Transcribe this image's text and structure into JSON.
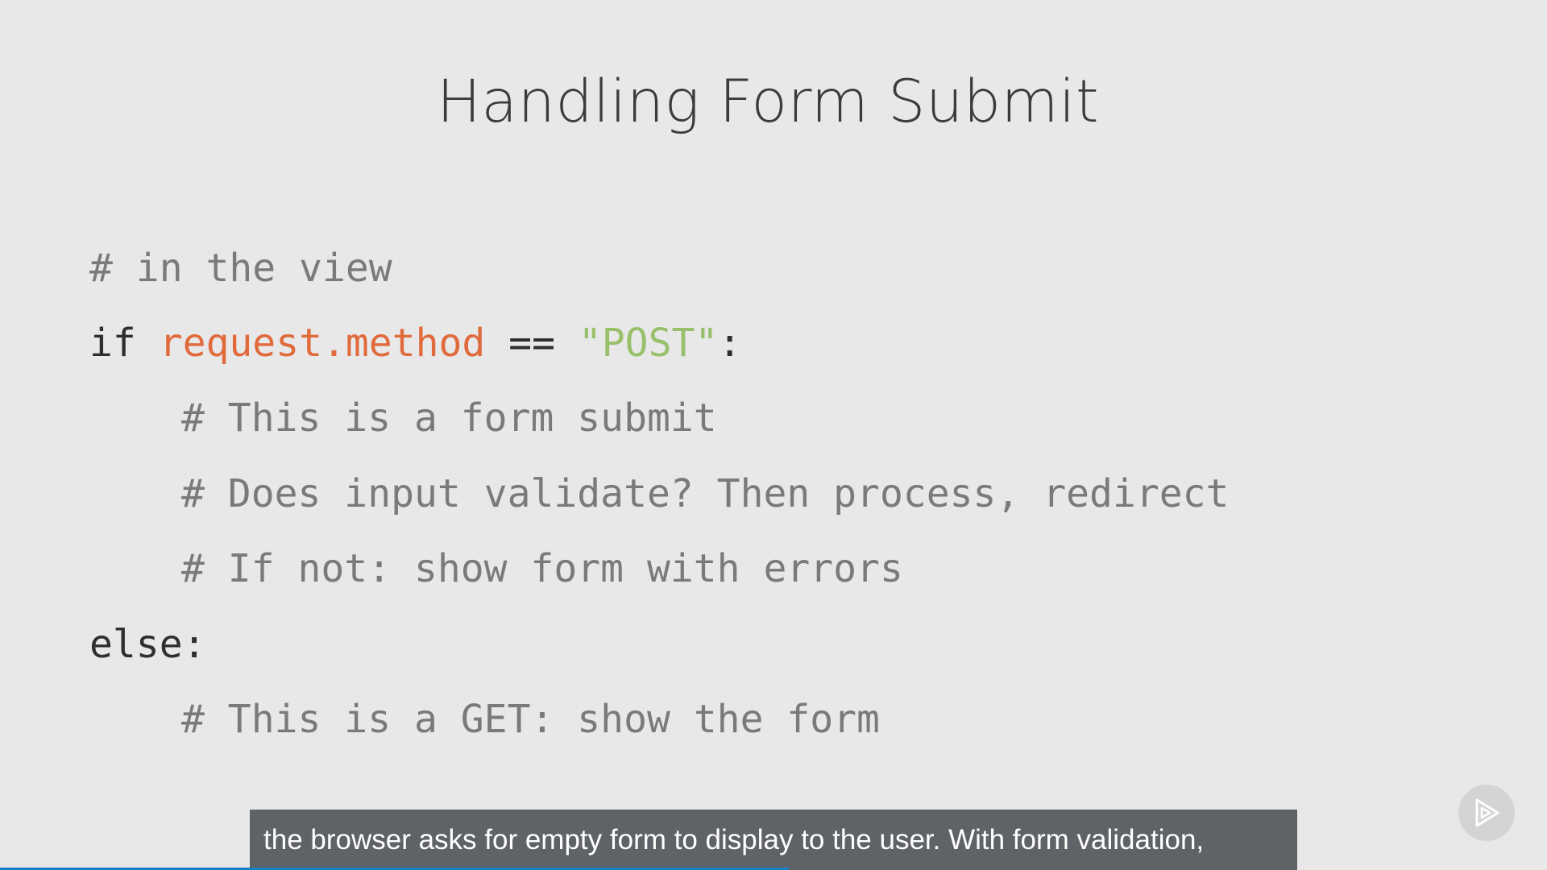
{
  "slide": {
    "title": "Handling Form Submit",
    "code": {
      "line1": "# in the view",
      "line2_kw": "if ",
      "line2_attr": "request.method",
      "line2_op": " == ",
      "line2_str": "\"POST\"",
      "line2_colon": ":",
      "line3": "# This is a form submit",
      "line4": "# Does input validate? Then process, redirect",
      "line5": "# If not: show form with errors",
      "line6": "else:",
      "line7": "# This is a GET: show the form"
    }
  },
  "player": {
    "caption": "the browser asks for empty form to display to the user. With form validation,",
    "progress_percent": 51,
    "play_icon": "play-icon"
  },
  "colors": {
    "background": "#e8e8e8",
    "comment": "#7a7a7a",
    "attribute": "#e06a3c",
    "string": "#98c06a",
    "caption_bg": "#5f6266",
    "progress": "#1a7fc4"
  }
}
